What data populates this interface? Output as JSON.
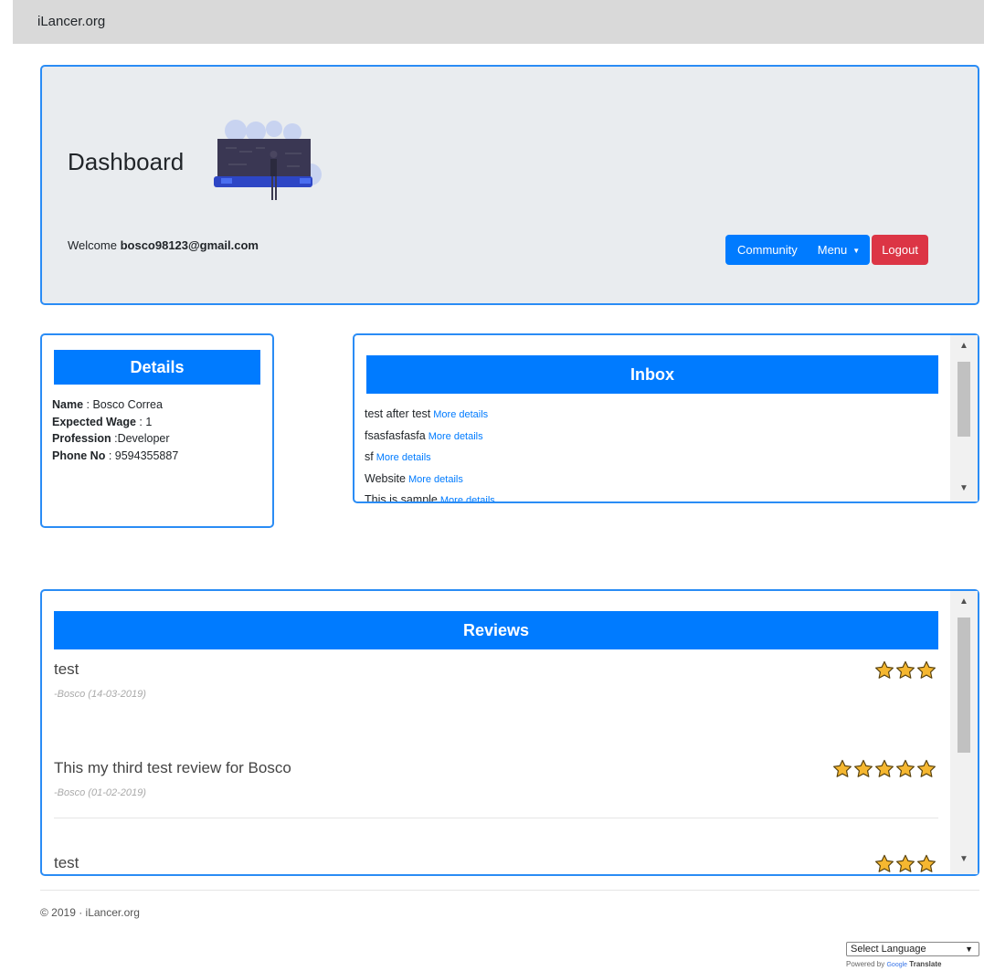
{
  "brand": "iLancer.org",
  "hero": {
    "title": "Dashboard",
    "welcome_prefix": "Welcome",
    "email": "bosco98123@gmail.com",
    "buttons": {
      "community": "Community",
      "menu": "Menu",
      "logout": "Logout"
    }
  },
  "details": {
    "heading": "Details",
    "rows": [
      {
        "label": "Name",
        "sep": " : ",
        "value": "Bosco Correa"
      },
      {
        "label": "Expected Wage",
        "sep": " : ",
        "value": "1"
      },
      {
        "label": "Profession",
        "sep": " :",
        "value": "Developer"
      },
      {
        "label": "Phone No",
        "sep": " : ",
        "value": "9594355887"
      }
    ]
  },
  "inbox": {
    "heading": "Inbox",
    "more_label": "More details",
    "messages": [
      "test after test",
      "fsasfasfasfa",
      "sf",
      "Website",
      "This is sample"
    ]
  },
  "reviews": {
    "heading": "Reviews",
    "items": [
      {
        "text": "test",
        "meta": "-Bosco (14-03-2019)",
        "stars": 3
      },
      {
        "text": "This my third test review for Bosco",
        "meta": "-Bosco (01-02-2019)",
        "stars": 5
      },
      {
        "text": "test",
        "meta": "",
        "stars": 3
      }
    ]
  },
  "footer": {
    "copyright": "© 2019 · iLancer.org",
    "language_select": "Select Language",
    "powered_by": "Powered by",
    "google": "Google",
    "translate": "Translate"
  },
  "colors": {
    "primary": "#007bff",
    "danger": "#dc3545",
    "border": "#2a8cf5",
    "hero_bg": "#e9ecef",
    "star": "#f5b730"
  },
  "icons": [
    "star-icon",
    "caret-down-icon",
    "scroll-up-icon",
    "scroll-down-icon"
  ]
}
